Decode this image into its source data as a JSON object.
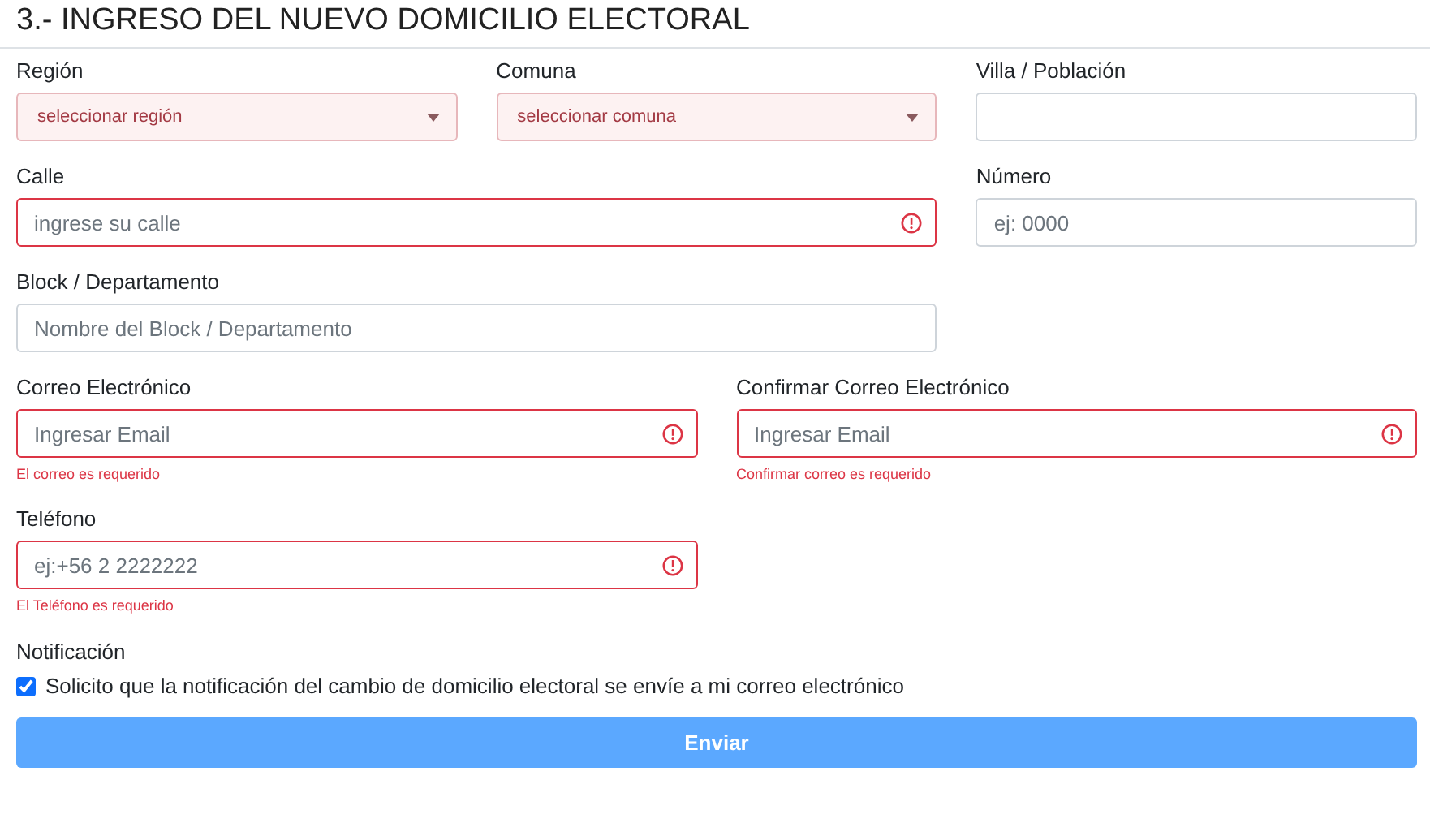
{
  "heading": "3.- INGRESO DEL NUEVO DOMICILIO ELECTORAL",
  "rows": [
    {
      "kind": "thirds",
      "fields": [
        {
          "kind": "select",
          "label": "Región",
          "placeholder": "seleccionar región",
          "invalid": true
        },
        {
          "kind": "select",
          "label": "Comuna",
          "placeholder": "seleccionar comuna",
          "invalid": true
        },
        {
          "kind": "input",
          "label": "Villa / Población",
          "invalid": false
        }
      ]
    },
    {
      "kind": "thirds",
      "fields": [
        {
          "kind": "input",
          "label": "Calle",
          "placeholder": "ingrese su calle",
          "invalid": true,
          "wide": true
        },
        {
          "kind": "input",
          "label": "Número",
          "placeholder": "ej: 0000",
          "invalid": false
        }
      ]
    },
    {
      "kind": "thirds",
      "fields": [
        {
          "kind": "input",
          "label": "Block / Departamento",
          "placeholder": "Nombre del Block / Departamento",
          "invalid": false,
          "wide": true
        }
      ]
    },
    {
      "kind": "halves",
      "fields": [
        {
          "kind": "input",
          "label": "Correo Electrónico",
          "placeholder": "Ingresar Email",
          "invalid": true,
          "error": "El correo es requerido"
        },
        {
          "kind": "input",
          "label": "Confirmar Correo Electrónico",
          "placeholder": "Ingresar Email",
          "invalid": true,
          "error": "Confirmar correo es requerido"
        }
      ]
    },
    {
      "kind": "halves",
      "fields": [
        {
          "kind": "input",
          "label": "Teléfono",
          "placeholder": "ej:+56 2 2222222",
          "invalid": true,
          "error": "El Teléfono es requerido"
        }
      ]
    }
  ],
  "notification": {
    "label": "Notificación",
    "option": "Solicito que la notificación del cambio de domicilio electoral se envíe a mi correo electrónico",
    "checked": true
  },
  "submit": {
    "label": "Enviar",
    "disabled": true
  }
}
